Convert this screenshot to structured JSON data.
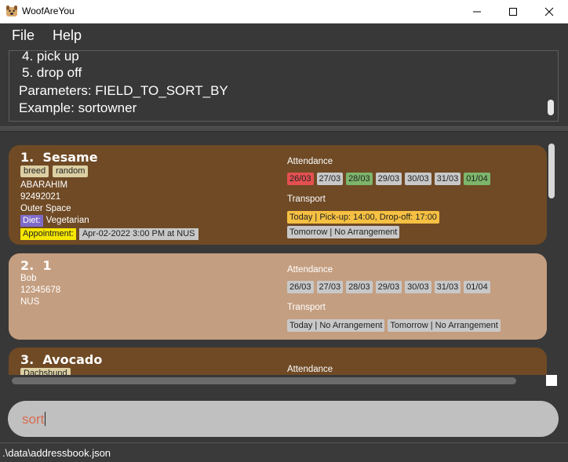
{
  "window": {
    "title": "WoofAreYou"
  },
  "menu": {
    "file": "File",
    "help": "Help"
  },
  "result": {
    "lines": [
      "4. pick up",
      "5. drop off",
      "Parameters: FIELD_TO_SORT_BY",
      "Example: sortowner"
    ]
  },
  "cards": [
    {
      "index": "1.",
      "name": "Sesame",
      "tags": [
        "breed",
        "random"
      ],
      "owner": "ABARAHIM",
      "phone": "92492021",
      "address": "Outer Space",
      "diet_label": "Diet:",
      "diet": "Vegetarian",
      "appointment_label": "Appointment:",
      "appointment": "Apr-02-2022 3:00 PM at NUS",
      "attendance_label": "Attendance",
      "attendance": [
        {
          "date": "26/03",
          "status": "absent"
        },
        {
          "date": "27/03",
          "status": "none"
        },
        {
          "date": "28/03",
          "status": "present"
        },
        {
          "date": "29/03",
          "status": "none"
        },
        {
          "date": "30/03",
          "status": "none"
        },
        {
          "date": "31/03",
          "status": "none"
        },
        {
          "date": "01/04",
          "status": "present"
        }
      ],
      "transport_label": "Transport",
      "transport": [
        "Today | Pick-up: 14:00, Drop-off: 17:00",
        "Tomorrow | No Arrangement"
      ]
    },
    {
      "index": "2.",
      "name": "1",
      "owner": "Bob",
      "phone": "12345678",
      "address": "NUS",
      "attendance_label": "Attendance",
      "attendance": [
        {
          "date": "26/03",
          "status": "none"
        },
        {
          "date": "27/03",
          "status": "none"
        },
        {
          "date": "28/03",
          "status": "none"
        },
        {
          "date": "29/03",
          "status": "none"
        },
        {
          "date": "30/03",
          "status": "none"
        },
        {
          "date": "31/03",
          "status": "none"
        },
        {
          "date": "01/04",
          "status": "none"
        }
      ],
      "transport_label": "Transport",
      "transport": [
        "Today | No Arrangement",
        "Tomorrow | No Arrangement"
      ]
    },
    {
      "index": "3.",
      "name": "Avocado",
      "tags": [
        "Dachshund"
      ],
      "attendance_label": "Attendance"
    }
  ],
  "command": {
    "value": "sort"
  },
  "status": {
    "path": ".\\data\\addressbook.json"
  },
  "colors": {
    "card_dark": "#6f4a25",
    "card_light": "#c49e80",
    "absent": "#e45050",
    "present": "#7db56a",
    "transport_today": "#f6c042",
    "command_text": "#d86b50"
  }
}
